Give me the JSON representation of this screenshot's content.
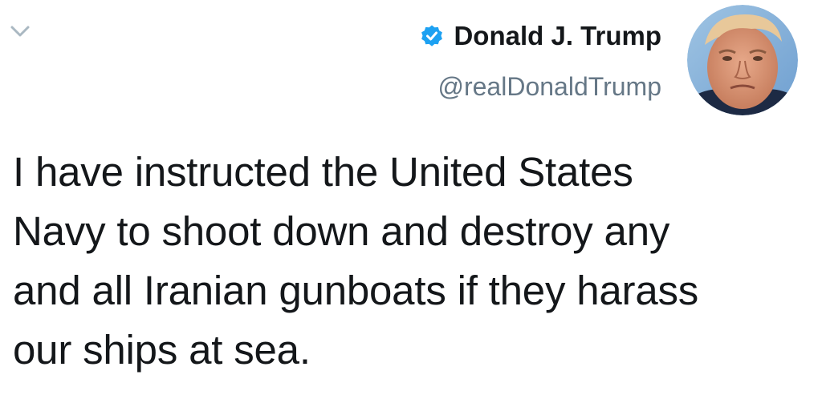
{
  "tweet": {
    "author": {
      "display_name": "Donald J. Trump",
      "handle": "@realDonaldTrump",
      "verified": true
    },
    "text_lines": [
      "I have instructed the United States",
      "Navy to shoot down and destroy any",
      "and all Iranian gunboats if they harass",
      "our ships at sea."
    ]
  },
  "icons": {
    "menu": "chevron-down-icon",
    "verified": "verified-badge-icon"
  },
  "colors": {
    "verified_blue": "#1da1f2",
    "text": "#14171a",
    "secondary_text": "#657786",
    "chevron": "#aab8c2"
  }
}
